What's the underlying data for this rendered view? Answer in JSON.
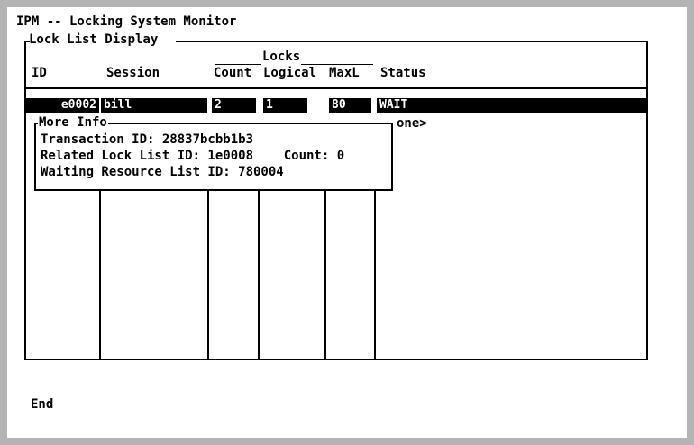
{
  "app": {
    "title": "IPM -- Locking System Monitor"
  },
  "panel": {
    "title": "Lock List Display"
  },
  "columns": {
    "group_locks": "Locks",
    "id": "ID",
    "session": "Session",
    "count": "Count",
    "logical": "Logical",
    "maxl": "MaxL",
    "status": "Status"
  },
  "rows": [
    {
      "id": "e0002",
      "session": "bill",
      "count": "2",
      "logical": "1",
      "maxl": "80",
      "status": "WAIT"
    }
  ],
  "hidden_text": "one>",
  "more_info": {
    "title": "More Info",
    "transaction": "Transaction ID: 28837bcbb1b3",
    "related": "Related Lock List ID: 1e0008    Count: 0",
    "waiting": "Waiting Resource List ID: 780004"
  },
  "footer": {
    "command": "End"
  }
}
